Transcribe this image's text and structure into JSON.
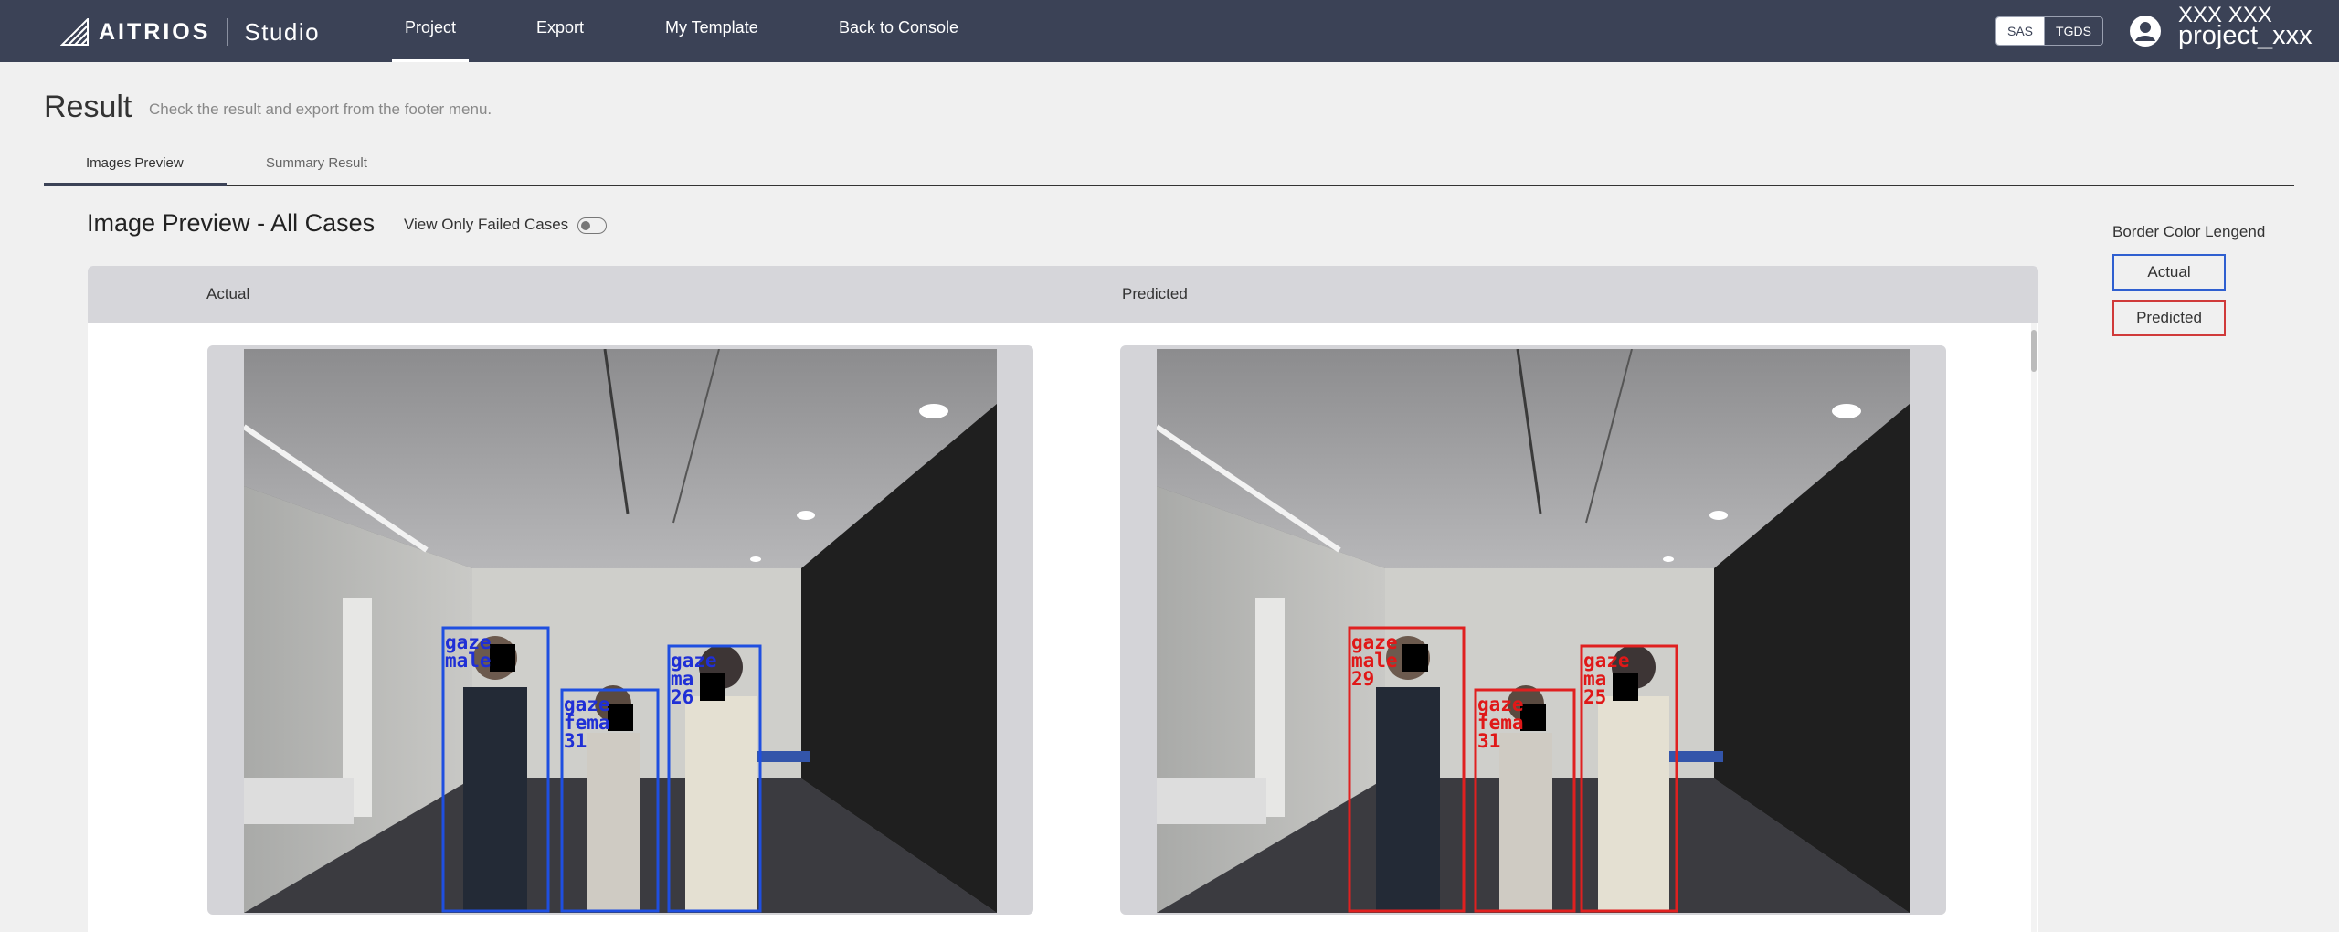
{
  "brand": {
    "name": "AITRIOS",
    "product": "Studio"
  },
  "nav": {
    "items": [
      "Project",
      "Export",
      "My Template",
      "Back to Console"
    ],
    "active": "Project"
  },
  "mode_toggle": {
    "options": [
      "SAS",
      "TGDS"
    ],
    "selected": "SAS"
  },
  "user": {
    "name": "XXX XXX",
    "project": "project_xxx"
  },
  "page": {
    "title": "Result",
    "subtitle": "Check the result and export from the footer menu.",
    "tabs": [
      "Images Preview",
      "Summary Result"
    ],
    "active_tab": "Images Preview"
  },
  "preview": {
    "title": "Image Preview - All Cases",
    "failed_toggle_label": "View Only Failed Cases",
    "failed_toggle_on": false,
    "columns": {
      "actual": "Actual",
      "predicted": "Predicted"
    }
  },
  "actual_labels": [
    "gaze",
    "male",
    "gaze",
    "fema",
    "31",
    "gaze",
    "ma",
    "26"
  ],
  "predicted_labels": [
    "gaze",
    "male",
    "29",
    "gaze",
    "fema",
    "31",
    "gaze",
    "ma",
    "25"
  ],
  "legend": {
    "title": "Border Color Lengend",
    "actual": "Actual",
    "predicted": "Predicted",
    "actual_color": "#2f5fd0",
    "predicted_color": "#d03a3a"
  },
  "colors": {
    "navbar": "#3b4256",
    "background": "#f0f0f0",
    "actual_box": "#1f4fe0",
    "predicted_box": "#e02020"
  }
}
